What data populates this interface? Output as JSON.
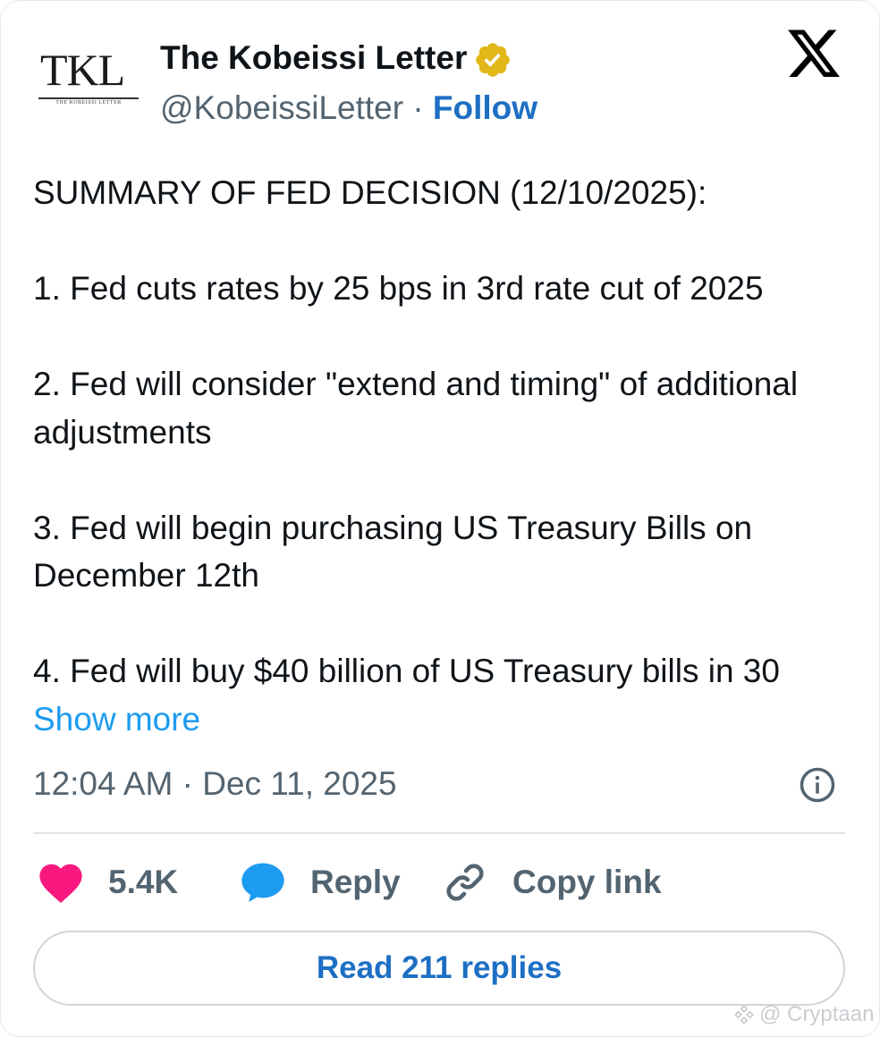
{
  "author": {
    "avatar_text": "TKL",
    "avatar_subtext": "THE KOBEISSI LETTER",
    "name": "The Kobeissi Letter",
    "handle": "@KobeissiLetter",
    "separator": "·",
    "follow_label": "Follow",
    "verified_color": "#e2b719"
  },
  "platform_icon": "x-logo-icon",
  "tweet": {
    "paragraphs": [
      "SUMMARY OF FED DECISION (12/10/2025):",
      "1. Fed cuts rates by 25 bps in 3rd rate cut of 2025",
      "2. Fed will consider \"extend and timing\" of additional adjustments",
      "3. Fed will begin purchasing US Treasury Bills on December 12th"
    ],
    "truncated_line": "4. Fed will buy $40 billion of US Treasury bills in 30",
    "show_more_label": "Show more"
  },
  "meta": {
    "timestamp": "12:04 AM · Dec 11, 2025"
  },
  "actions": {
    "like_count": "5.4K",
    "reply_label": "Reply",
    "copy_link_label": "Copy link",
    "like_color": "#f91880",
    "reply_color": "#1d9bf0"
  },
  "read_replies_label": "Read 211 replies",
  "watermark": "@ Cryptaan"
}
